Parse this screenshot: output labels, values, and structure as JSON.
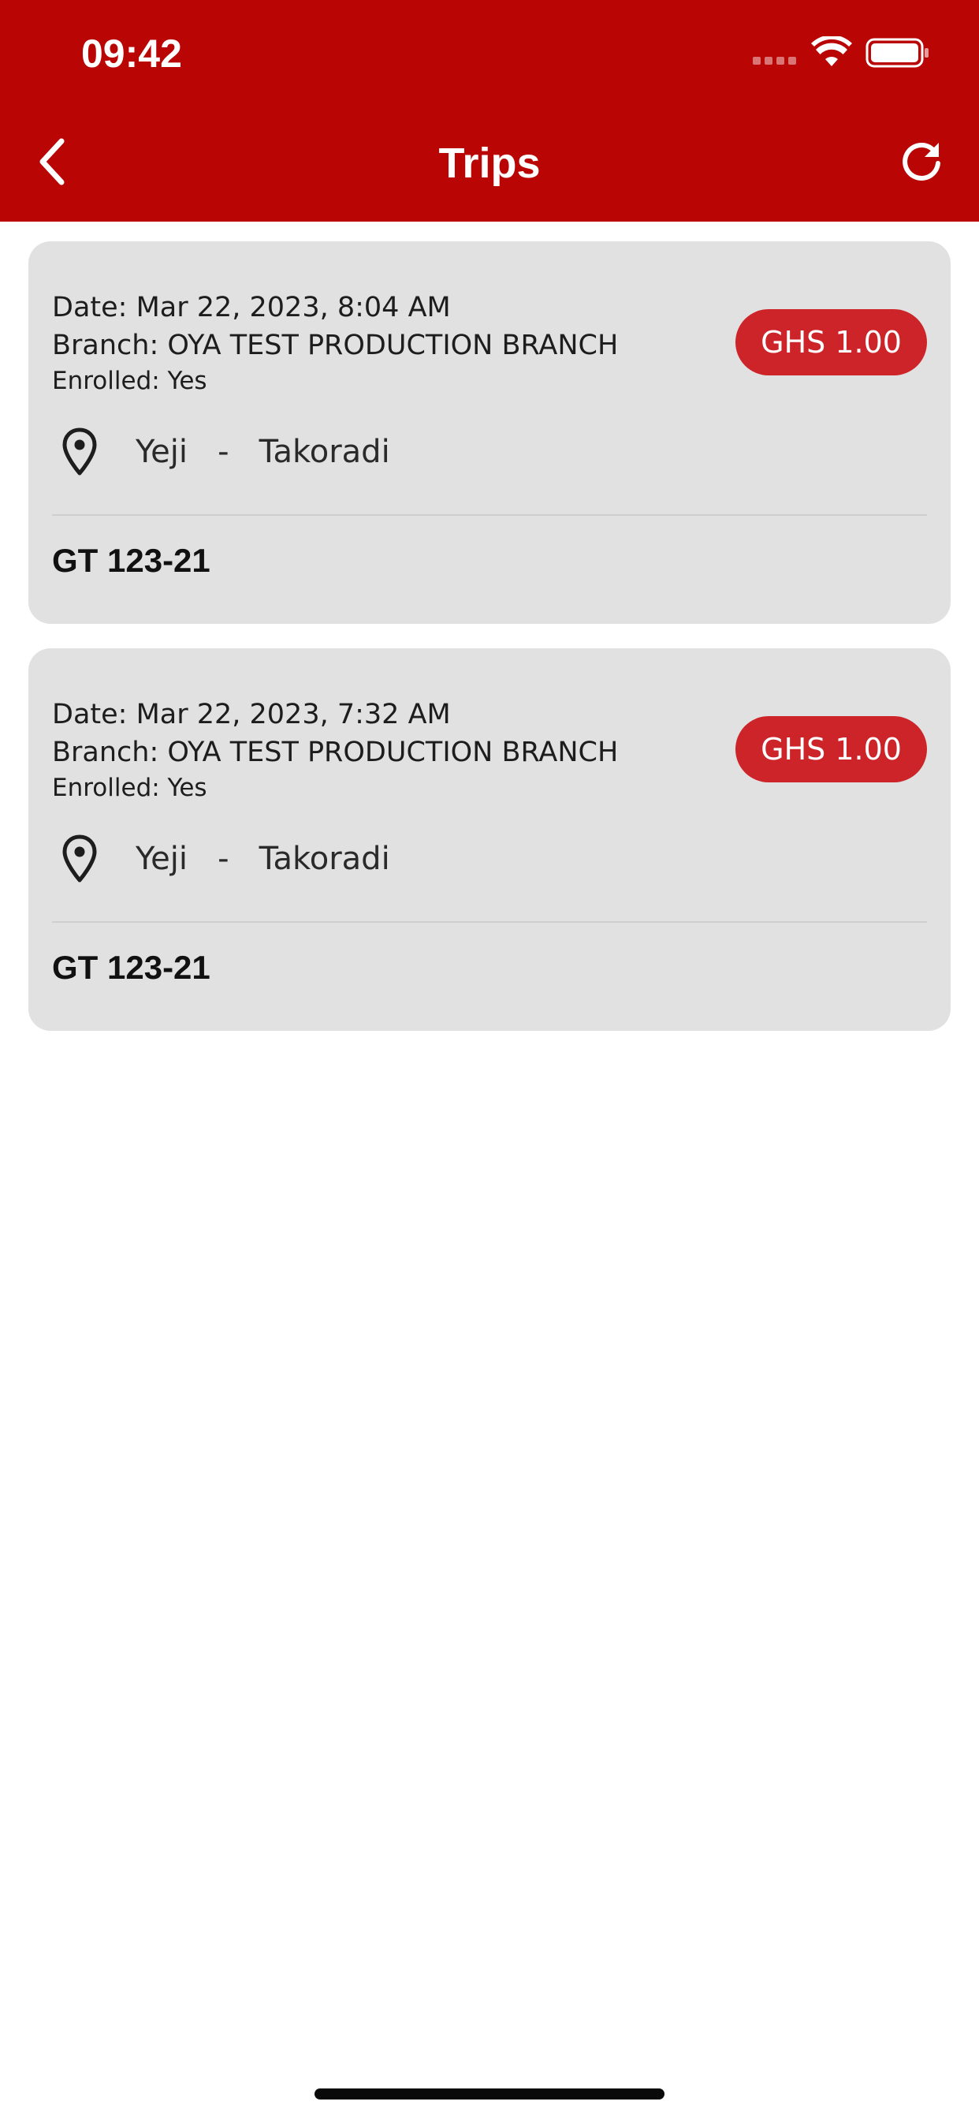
{
  "status_bar": {
    "time": "09:42"
  },
  "header": {
    "title": "Trips",
    "back_icon": "chevron-left-icon",
    "refresh_icon": "refresh-icon"
  },
  "trips": [
    {
      "date": "Date: Mar 22, 2023, 8:04 AM",
      "branch": "Branch: OYA TEST PRODUCTION BRANCH",
      "enrolled": "Enrolled: Yes",
      "price": "GHS 1.00",
      "route": "Yeji   -   Takoradi",
      "plate": "GT 123-21"
    },
    {
      "date": "Date: Mar 22, 2023, 7:32 AM",
      "branch": "Branch: OYA TEST PRODUCTION BRANCH",
      "enrolled": "Enrolled: Yes",
      "price": "GHS 1.00",
      "route": "Yeji   -   Takoradi",
      "plate": "GT 123-21"
    }
  ],
  "colors": {
    "header_bg": "#ba0505",
    "badge_bg": "#cc2429",
    "card_bg": "#e1e1e1"
  }
}
